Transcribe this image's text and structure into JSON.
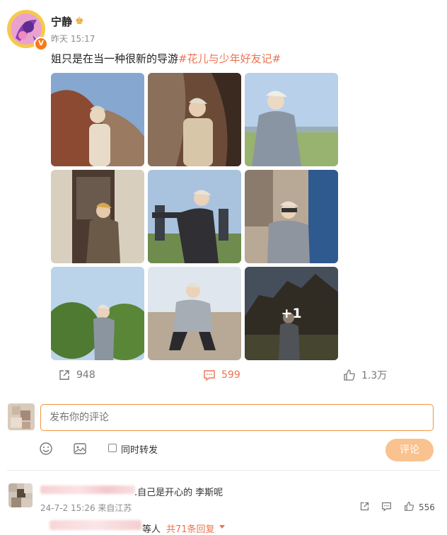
{
  "user": {
    "name": "宁静",
    "crown_icon": "crown-icon",
    "verified_icon": "verified-badge-icon",
    "verified_label": "V",
    "time": "昨天 15:17"
  },
  "post": {
    "text": "姐只是在当一种很新的导游",
    "hashtag": "#花儿与少年好友记#"
  },
  "photos": {
    "count": 9,
    "more_label": "+1"
  },
  "actions": {
    "repost_count": "948",
    "comment_count": "599",
    "like_count": "1.3万"
  },
  "composer": {
    "placeholder": "发布你的评论",
    "forward_label": "同时转发",
    "submit_label": "评论"
  },
  "comment": {
    "text": ".自己是开心的 李斯呢",
    "meta": "24-7-2 15:26 来自江苏",
    "like_count": "556",
    "reply_suffix": "等人",
    "reply_link": "共71条回复"
  },
  "colors": {
    "accent": "#eb7350",
    "button_disabled": "#f9c28e",
    "input_border": "#f29443"
  }
}
